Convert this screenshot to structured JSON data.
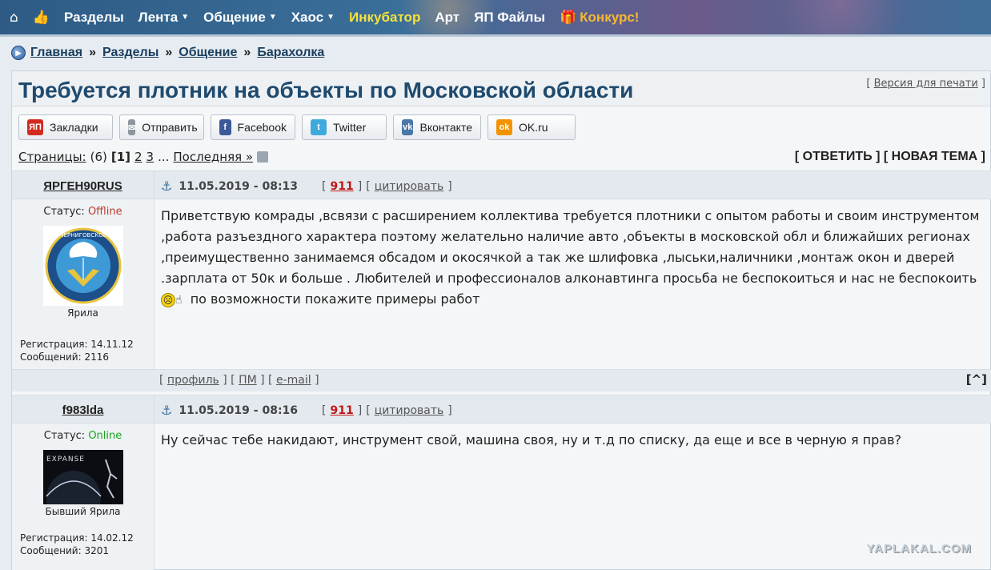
{
  "nav": {
    "items": [
      {
        "label": "Разделы",
        "caret": false,
        "style": "white"
      },
      {
        "label": "Лента",
        "caret": true,
        "style": "white"
      },
      {
        "label": "Общение",
        "caret": true,
        "style": "white"
      },
      {
        "label": "Хаос",
        "caret": true,
        "style": "white"
      },
      {
        "label": "Инкубатор",
        "caret": false,
        "style": "yellow"
      },
      {
        "label": "Арт",
        "caret": false,
        "style": "white"
      },
      {
        "label": "ЯП Файлы",
        "caret": false,
        "style": "white"
      },
      {
        "label": "Конкурс!",
        "caret": false,
        "style": "orange"
      }
    ],
    "caret_glyph": "▼"
  },
  "breadcrumb": {
    "items": [
      "Главная",
      "Разделы",
      "Общение",
      "Барахолка"
    ],
    "separator": "»"
  },
  "topic": {
    "title": "Требуется плотник на объекты по Московской области",
    "print_label": "Версия для печати"
  },
  "share": [
    {
      "label": "Закладки",
      "icon_text": "ЯП",
      "color": "#d42a1f",
      "icon": "yap-icon"
    },
    {
      "label": "Отправить",
      "icon_text": "✉",
      "color": "#8d969e",
      "icon": "mail-icon"
    },
    {
      "label": "Facebook",
      "icon_text": "f",
      "color": "#3b5998",
      "icon": "facebook-icon"
    },
    {
      "label": "Twitter",
      "icon_text": "t",
      "color": "#3ea9dd",
      "icon": "twitter-icon"
    },
    {
      "label": "Вконтакте",
      "icon_text": "vk",
      "color": "#4a76a8",
      "icon": "vk-icon"
    },
    {
      "label": "OK.ru",
      "icon_text": "ok",
      "color": "#f29400",
      "icon": "ok-icon"
    }
  ],
  "pagination": {
    "label": "Страницы:",
    "total": "(6)",
    "current": "[1]",
    "pages": [
      "2",
      "3"
    ],
    "ellipsis": "...",
    "last": "Последняя »",
    "reply": "[ ОТВЕТИТЬ ]",
    "new_topic": "[ НОВАЯ ТЕМА ]"
  },
  "posts": [
    {
      "author": "ЯРГЕН90RUS",
      "date": "11.05.2019 - 08:13",
      "post_num": "911",
      "quote_label": "цитировать",
      "status_label": "Статус:",
      "status": "Offline",
      "rank": "Ярила",
      "reg": "Регистрация: 14.11.12",
      "count": "Сообщений: 2116",
      "text_main": "Приветствую комрады ,всвязи с расширением коллектива требуется плотники с опытом работы и своим инструментом ,работа разъездного характера поэтому желательно наличие авто ,объекты в московской обл и ближайших регионах ,преимущественно занимаемся обсадом и окосячкой а так же шлифовка ,лыськи,наличники ,монтаж окон и дверей .зарплата от 50к и больше . Любителей и профессионалов алконавтинга просьба не беспокоиться и нас не беспокоить",
      "text_tail": "по возможности покажите примеры работ",
      "avatar_label": "ЧЕРНИГОВСКОЕ"
    },
    {
      "author": "f983lda",
      "date": "11.05.2019 - 08:16",
      "post_num": "911",
      "quote_label": "цитировать",
      "status_label": "Статус:",
      "status": "Online",
      "rank": "Бывший Ярила",
      "reg": "Регистрация: 14.02.12",
      "count": "Сообщений: 3201",
      "text_main": "Ну сейчас тебе накидают, инструмент свой, машина своя, ну и т.д по списку, да еще и все в черную я прав?",
      "avatar_label": "EXPANSE"
    }
  ],
  "post_footer": {
    "profile": "профиль",
    "pm": "ПМ",
    "email": "e-mail",
    "up": "[^]"
  },
  "watermark": "YAPLAKAL.COM",
  "colors": {
    "accent": "#1f4a6e",
    "offline": "#c0392b",
    "online": "#1aa31a",
    "post_num": "#c01818"
  }
}
